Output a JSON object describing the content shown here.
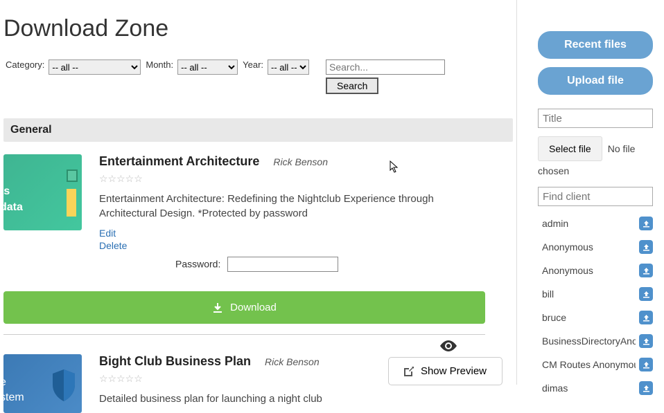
{
  "page": {
    "title": "Download Zone"
  },
  "filters": {
    "category_label": "Category:",
    "category_value": "-- all --",
    "month_label": "Month:",
    "month_value": "-- all --",
    "year_label": "Year:",
    "year_value": "-- all --",
    "search_placeholder": "Search...",
    "search_button": "Search"
  },
  "section": {
    "header": "General"
  },
  "files": [
    {
      "title": "Entertainment Architecture",
      "author": "Rick Benson",
      "stars": "☆☆☆☆☆",
      "desc": "Entertainment Architecture: Redefining the Nightclub Experience through Architectural Design. *Protected by password",
      "edit": "Edit",
      "delete": "Delete",
      "password_label": "Password:",
      "thumb": {
        "line1": "ts",
        "line2": "data"
      }
    },
    {
      "title": "Bight Club Business Plan",
      "author": "Rick Benson",
      "stars": "☆☆☆☆☆",
      "desc": "Detailed business plan for launching a night club",
      "thumb": {
        "line1": "e",
        "line2": "stem"
      }
    }
  ],
  "download_button": "Download",
  "show_preview": "Show Preview",
  "sidebar": {
    "recent_files": "Recent files",
    "upload_file": "Upload file",
    "title_placeholder": "Title",
    "select_file": "Select file",
    "no_file": "No file",
    "chosen": "chosen",
    "find_client_placeholder": "Find client",
    "clients": [
      {
        "name": "admin"
      },
      {
        "name": "Anonymous"
      },
      {
        "name": "Anonymous"
      },
      {
        "name": "bill"
      },
      {
        "name": "bruce"
      },
      {
        "name": "BusinessDirectoryAnonymous"
      },
      {
        "name": "CM Routes Anonymous"
      },
      {
        "name": "dimas"
      }
    ]
  }
}
